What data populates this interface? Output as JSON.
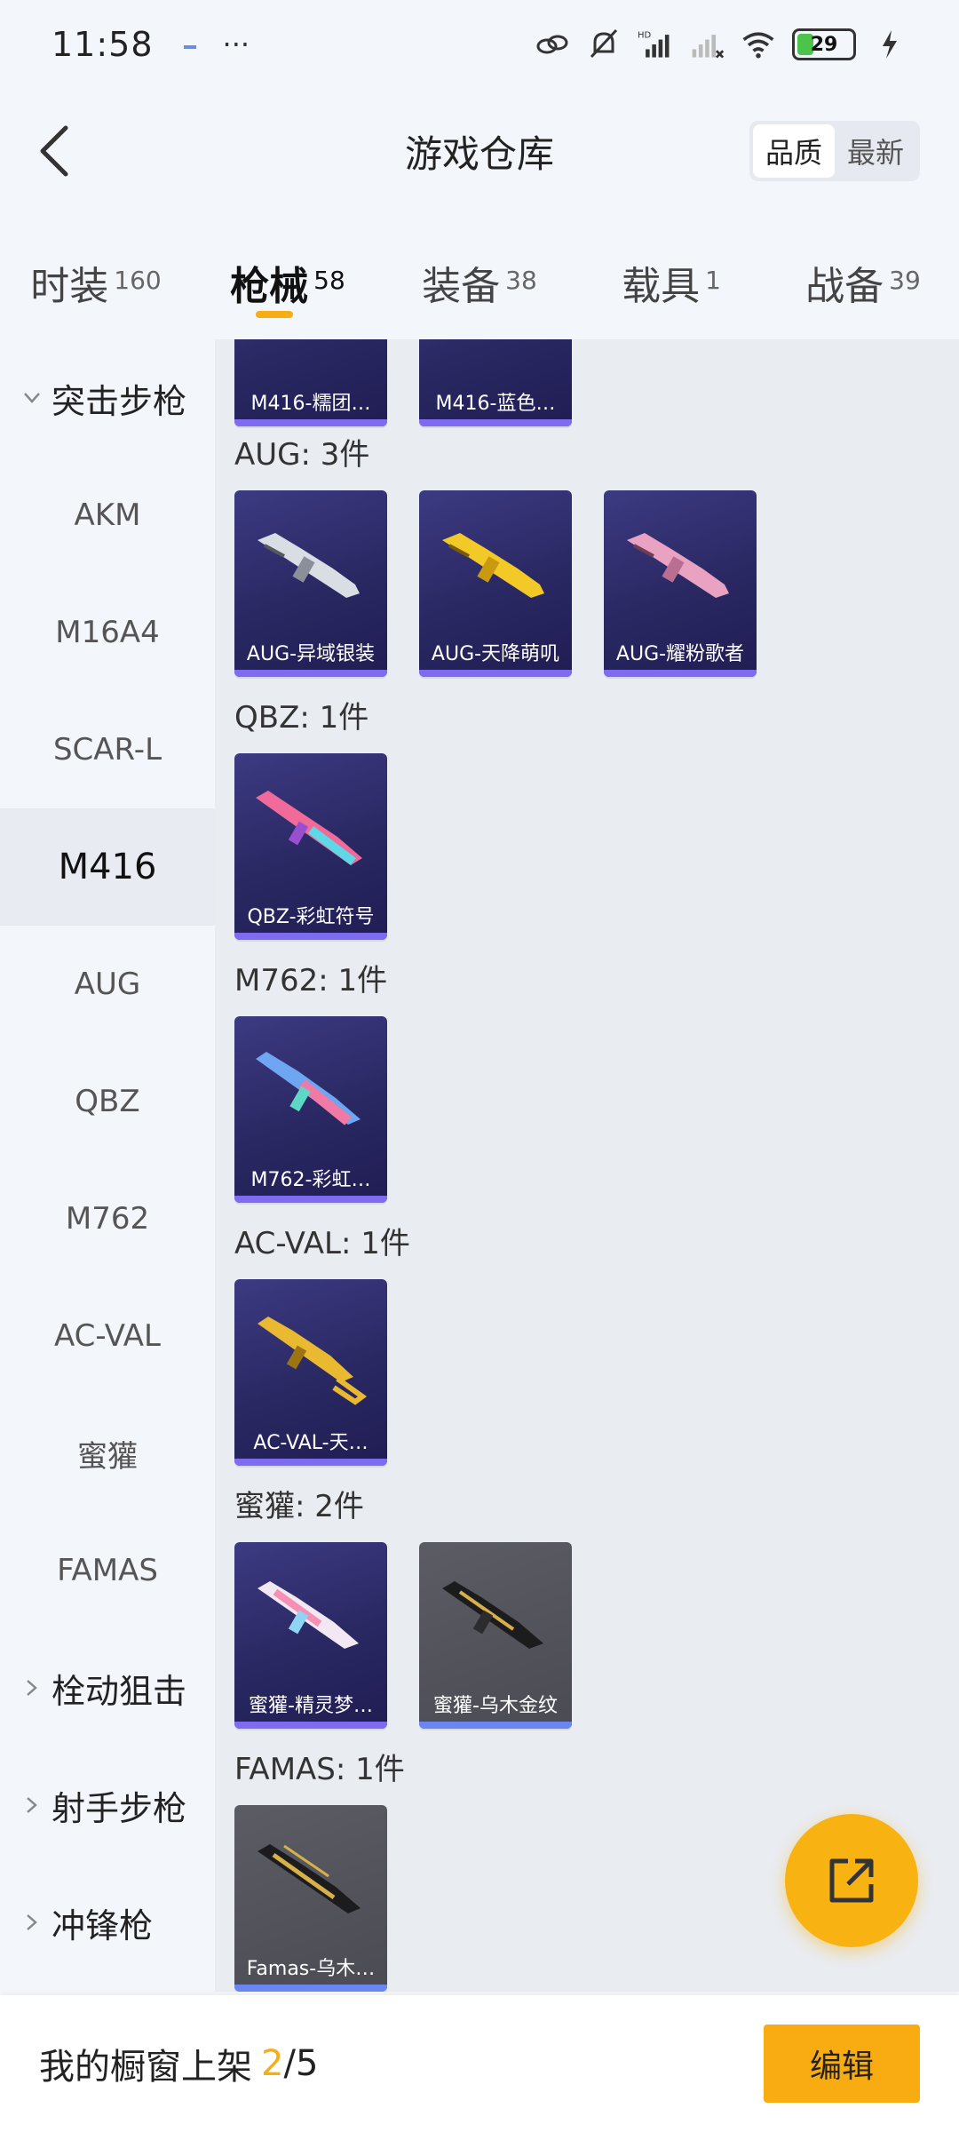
{
  "status_bar": {
    "time": "11:58",
    "battery": "29"
  },
  "header": {
    "title": "游戏仓库",
    "sort_quality": "品质",
    "sort_newest": "最新"
  },
  "tabs": [
    {
      "label": "时装",
      "count": "160"
    },
    {
      "label": "枪械",
      "count": "58"
    },
    {
      "label": "装备",
      "count": "38"
    },
    {
      "label": "载具",
      "count": "1"
    },
    {
      "label": "战备",
      "count": "39"
    }
  ],
  "sidebar": {
    "group_open": "突击步枪",
    "items": [
      "AKM",
      "M16A4",
      "SCAR-L",
      "M416",
      "AUG",
      "QBZ",
      "M762",
      "AC-VAL",
      "蜜獾",
      "FAMAS"
    ],
    "groups_closed": [
      "栓动狙击",
      "射手步枪",
      "冲锋枪"
    ]
  },
  "sections": [
    {
      "title": "",
      "cards": [
        "M416-糯团…",
        "M416-蓝色…"
      ]
    },
    {
      "title": "AUG: 3件",
      "cards": [
        "AUG-异域银装",
        "AUG-天降萌叽",
        "AUG-耀粉歌者"
      ]
    },
    {
      "title": "QBZ: 1件",
      "cards": [
        "QBZ-彩虹符号"
      ]
    },
    {
      "title": "M762: 1件",
      "cards": [
        "M762-彩虹…"
      ]
    },
    {
      "title": "AC-VAL: 1件",
      "cards": [
        "AC-VAL-天…"
      ]
    },
    {
      "title": "蜜獾: 2件",
      "cards": [
        "蜜獾-精灵梦…",
        "蜜獾-乌木金纹"
      ]
    },
    {
      "title": "FAMAS: 1件",
      "cards": [
        "Famas-乌木…"
      ]
    }
  ],
  "bottom_bar": {
    "label": "我的橱窗上架",
    "current": "2",
    "sep": "/",
    "total": "5",
    "edit_label": "编辑"
  },
  "colors": {
    "accent": "#f8b313",
    "card_purple": "#2a2862",
    "card_gray": "#4a4b53"
  }
}
